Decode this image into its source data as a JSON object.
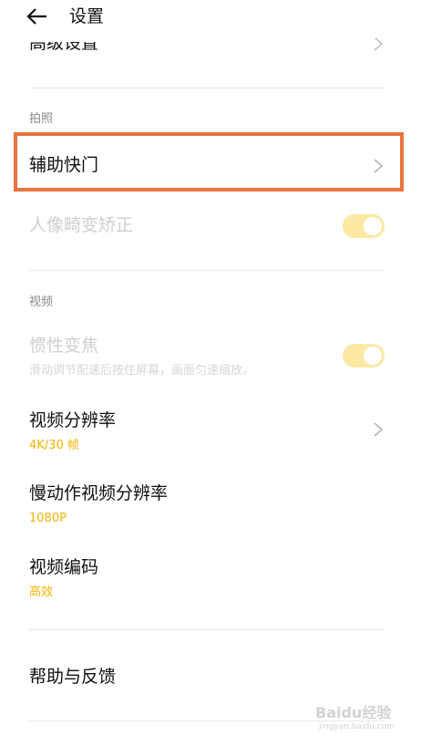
{
  "header": {
    "title": "设置",
    "back_icon": "arrow-left-icon"
  },
  "top_item": {
    "label": "高级设置"
  },
  "sections": {
    "photo": "拍照",
    "video": "视频"
  },
  "items": {
    "assist_shutter": {
      "label": "辅助快门"
    },
    "portrait_correction": {
      "label": "人像畸变矫正",
      "toggle": true
    },
    "inertia_zoom": {
      "label": "惯性变焦",
      "description": "滑动调节配速后按住屏幕，画面匀速缩放。",
      "toggle": true
    },
    "video_resolution": {
      "label": "视频分辨率",
      "value": "4K/30 帧"
    },
    "slowmo_resolution": {
      "label": "慢动作视频分辨率",
      "value": "1080P"
    },
    "video_codec": {
      "label": "视频编码",
      "value": "高效"
    },
    "help_feedback": {
      "label": "帮助与反馈"
    }
  },
  "watermark": {
    "brand": "Baidu经验",
    "url": "jingyan.baidu.com"
  },
  "colors": {
    "accent": "#f0b400",
    "highlight_border": "#e8743f",
    "toggle_bg": "#fbe9a4"
  }
}
